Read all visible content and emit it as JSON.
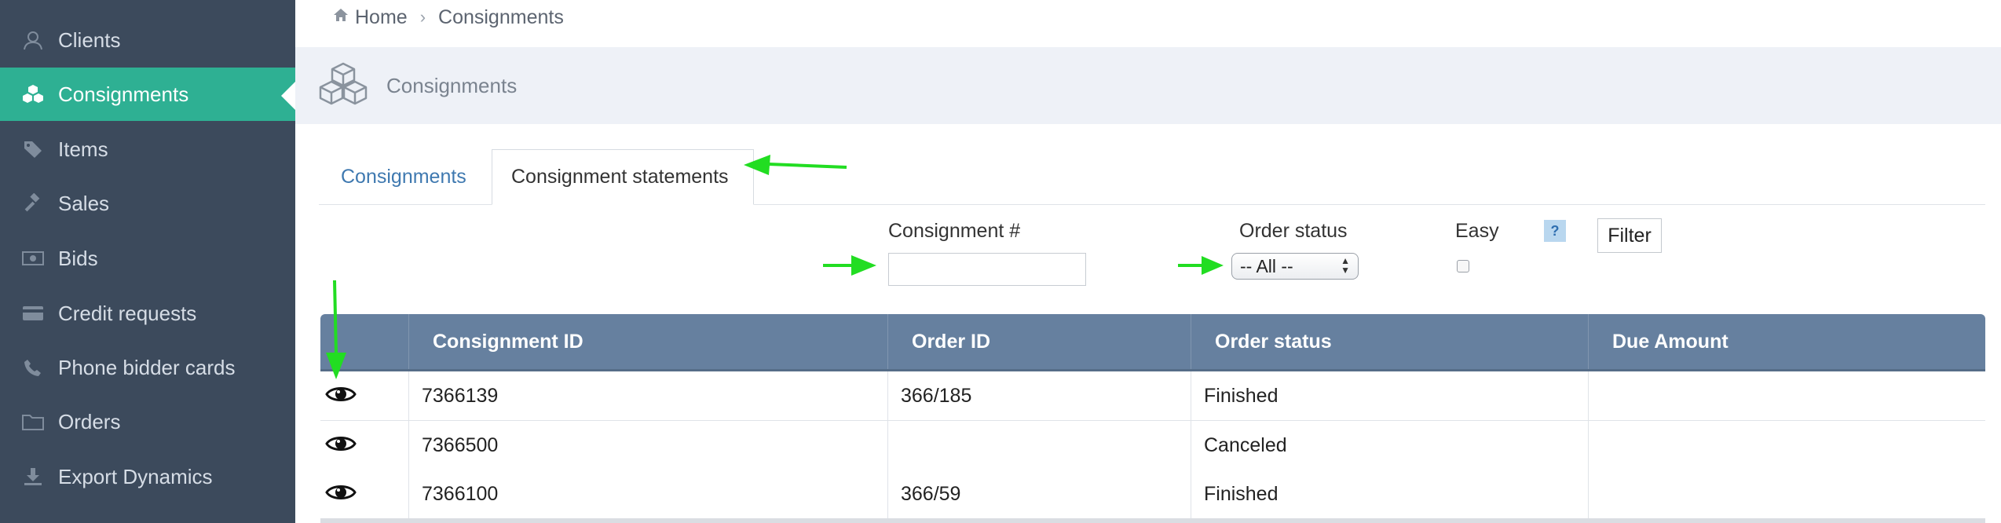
{
  "sidebar": {
    "items": [
      {
        "label": "Clients",
        "icon": "user-icon",
        "active": false
      },
      {
        "label": "Consignments",
        "icon": "cubes-icon",
        "active": true
      },
      {
        "label": "Items",
        "icon": "tags-icon",
        "active": false
      },
      {
        "label": "Sales",
        "icon": "gavel-icon",
        "active": false
      },
      {
        "label": "Bids",
        "icon": "money-icon",
        "active": false
      },
      {
        "label": "Credit requests",
        "icon": "credit-card-icon",
        "active": false
      },
      {
        "label": "Phone bidder cards",
        "icon": "phone-icon",
        "active": false
      },
      {
        "label": "Orders",
        "icon": "folder-icon",
        "active": false
      },
      {
        "label": "Export Dynamics",
        "icon": "download-icon",
        "active": false
      }
    ],
    "bg_color": "#3c4a5c",
    "active_color": "#2eb093"
  },
  "breadcrumb": {
    "home": "Home",
    "current": "Consignments"
  },
  "header": {
    "title": "Consignments",
    "icon": "cubes-icon"
  },
  "tabs": [
    {
      "label": "Consignments",
      "active": false
    },
    {
      "label": "Consignment statements",
      "active": true
    }
  ],
  "filters": {
    "consignment_label": "Consignment #",
    "consignment_value": "",
    "order_status_label": "Order status",
    "order_status_selected": "-- All --",
    "easy_label": "Easy",
    "help": "?",
    "filter_button": "Filter"
  },
  "table": {
    "headers": [
      "",
      "Consignment ID",
      "Order ID",
      "Order status",
      "Due Amount"
    ],
    "rows": [
      {
        "consignment_id": "7366139",
        "order_id": "366/185",
        "status": "Finished",
        "due": ""
      },
      {
        "consignment_id": "7366500",
        "order_id": "",
        "status": "Canceled",
        "due": ""
      },
      {
        "consignment_id": "7366100",
        "order_id": "366/59",
        "status": "Finished",
        "due": ""
      }
    ],
    "header_color": "#66809f"
  },
  "annotation_color": "#22dd22"
}
